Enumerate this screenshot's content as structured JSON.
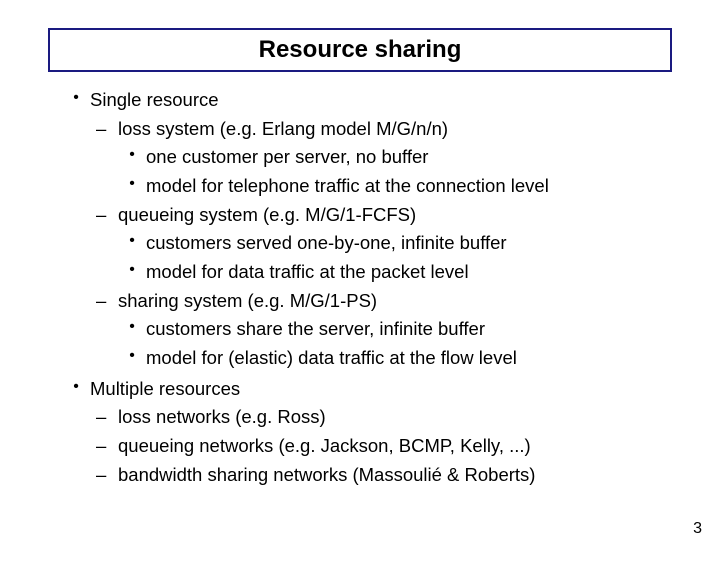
{
  "title": "Resource sharing",
  "bullets": {
    "b1": "Single resource",
    "b1a": "loss system (e.g. Erlang model M/G/n/n)",
    "b1a1": "one customer per server, no buffer",
    "b1a2": "model for telephone traffic at the connection level",
    "b1b": "queueing system (e.g. M/G/1-FCFS)",
    "b1b1": "customers served one-by-one, infinite buffer",
    "b1b2": "model for data traffic at the packet level",
    "b1c": "sharing system (e.g. M/G/1-PS)",
    "b1c1": "customers share the server, infinite buffer",
    "b1c2": "model for (elastic) data traffic at the flow level",
    "b2": "Multiple resources",
    "b2a": "loss networks (e.g. Ross)",
    "b2b": "queueing networks (e.g. Jackson, BCMP, Kelly, ...)",
    "b2c": "bandwidth sharing networks (Massoulié & Roberts)"
  },
  "page_number": "3"
}
